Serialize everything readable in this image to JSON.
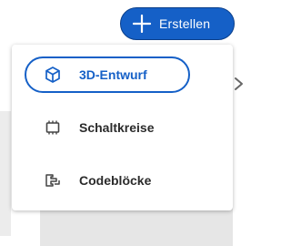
{
  "header": {
    "create_button": {
      "label": "Erstellen",
      "icon": "plus-icon"
    }
  },
  "create_menu": {
    "items": [
      {
        "label": "3D-Entwurf",
        "icon": "cube-icon",
        "selected": true
      },
      {
        "label": "Schaltkreise",
        "icon": "chip-icon",
        "selected": false
      },
      {
        "label": "Codeblöcke",
        "icon": "code-blocks-icon",
        "selected": false
      }
    ]
  },
  "colors": {
    "accent": "#1560c7",
    "text": "#2b2b2b"
  }
}
